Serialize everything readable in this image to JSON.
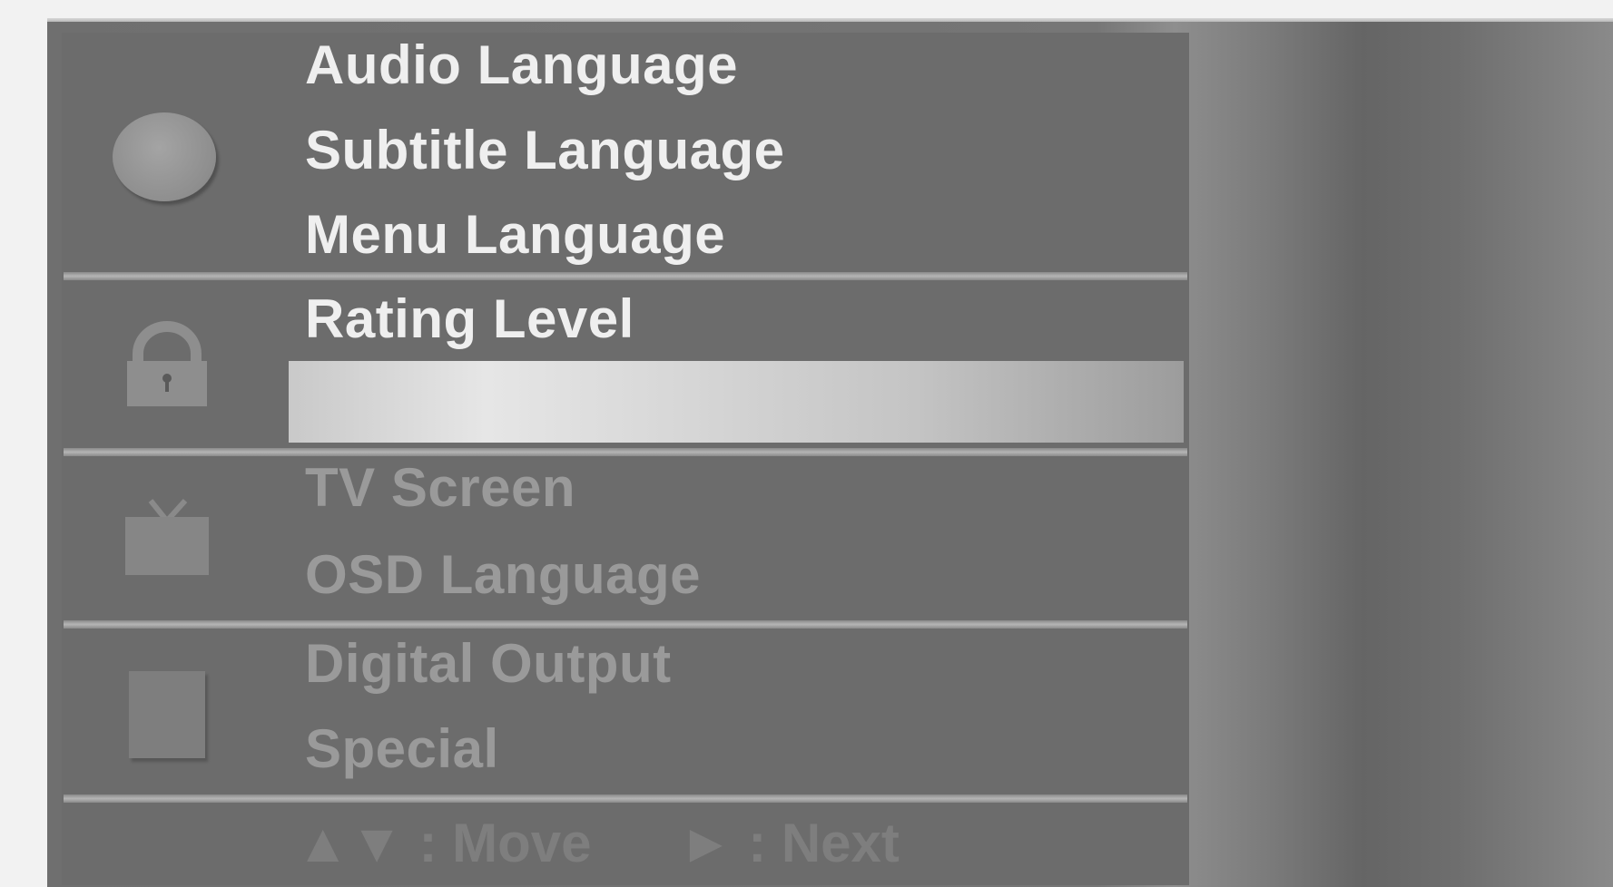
{
  "menu": {
    "sections": [
      {
        "icon": "disc-icon",
        "items": [
          "Audio Language",
          "Subtitle Language",
          "Menu Language"
        ]
      },
      {
        "icon": "lock-icon",
        "items": [
          "Rating Level"
        ]
      },
      {
        "icon": "tv-icon",
        "items": [
          "TV Screen",
          "OSD Language"
        ]
      },
      {
        "icon": "other-icon",
        "items": [
          "Digital Output",
          "Special"
        ]
      }
    ]
  },
  "footer": {
    "move_label": "▲▼ : Move",
    "next_label": "► : Next"
  },
  "colors": {
    "panel": "#6c6c6c",
    "highlight": "#d6d6d6",
    "text_bright": "#efefef",
    "text_dim": "#9a9a9a"
  }
}
